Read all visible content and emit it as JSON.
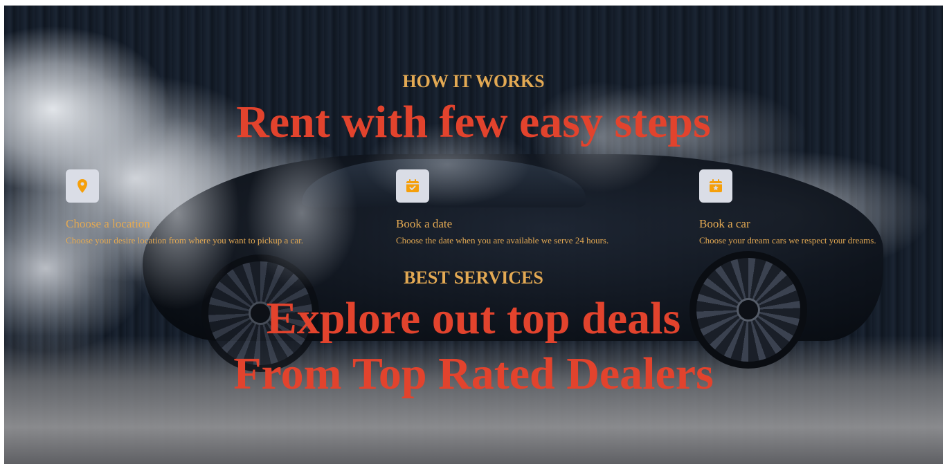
{
  "how_it_works": {
    "eyebrow": "HOW IT WORKS",
    "headline": "Rent with few easy steps",
    "steps": [
      {
        "icon": "location-pin-icon",
        "title": "Choose a location",
        "text": "Choose your desire location from where you want to pickup a car."
      },
      {
        "icon": "calendar-check-icon",
        "title": "Book a date",
        "text": "Choose the date when you are available we serve 24 hours."
      },
      {
        "icon": "calendar-star-icon",
        "title": "Book a car",
        "text": "Choose your dream cars we respect your dreams."
      }
    ]
  },
  "best_services": {
    "eyebrow": "BEST SERVICES",
    "headline_line_1": "Explore out top deals",
    "headline_line_2": "From Top Rated Dealers"
  },
  "colors": {
    "accent_gold": "#e3a953",
    "headline_red": "#e2432d",
    "icon_orange": "#f59f0a",
    "icon_box_bg": "#dadde6"
  }
}
